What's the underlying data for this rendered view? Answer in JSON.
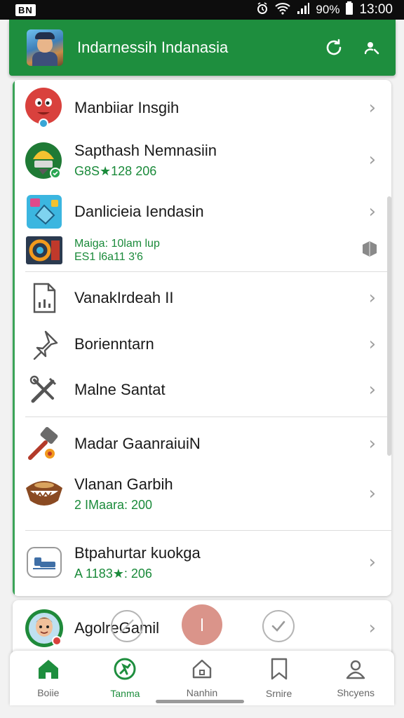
{
  "status_bar": {
    "badge": "BN",
    "battery": "90%",
    "time": "13:00"
  },
  "appbar": {
    "title": "Indarnessih Indanasia"
  },
  "card": {
    "items": [
      {
        "label": "Manbiiar Insgih"
      },
      {
        "label": "Sapthash Nemnasiin",
        "sub": "G8S★128 206"
      },
      {
        "label": "Danlicieia Iendasin"
      },
      {
        "line1": "Maiga: 10lam lup",
        "line2": "ES1 l6a11 3'6"
      },
      {
        "label": "VanakIrdeah II"
      },
      {
        "label": "Borienntarn"
      },
      {
        "label": "Malne Santat"
      },
      {
        "label": "Madar GaanraiuiN"
      },
      {
        "label": "Vlanan Garbih",
        "sub": "2 IMaara: 200"
      },
      {
        "label": "Btpahurtar kuokga",
        "sub": "A 1183★: 206"
      }
    ]
  },
  "card2": {
    "label": "AgolreGamil"
  },
  "nav": {
    "items": [
      {
        "label": "Boiie"
      },
      {
        "label": "Tanma"
      },
      {
        "label": "Nanhin"
      },
      {
        "label": "Srnire"
      },
      {
        "label": "Shcyens"
      }
    ]
  },
  "colors": {
    "primary": "#1e8e3e",
    "accent_text": "#1a8a3a",
    "fab": "#d98f84"
  }
}
